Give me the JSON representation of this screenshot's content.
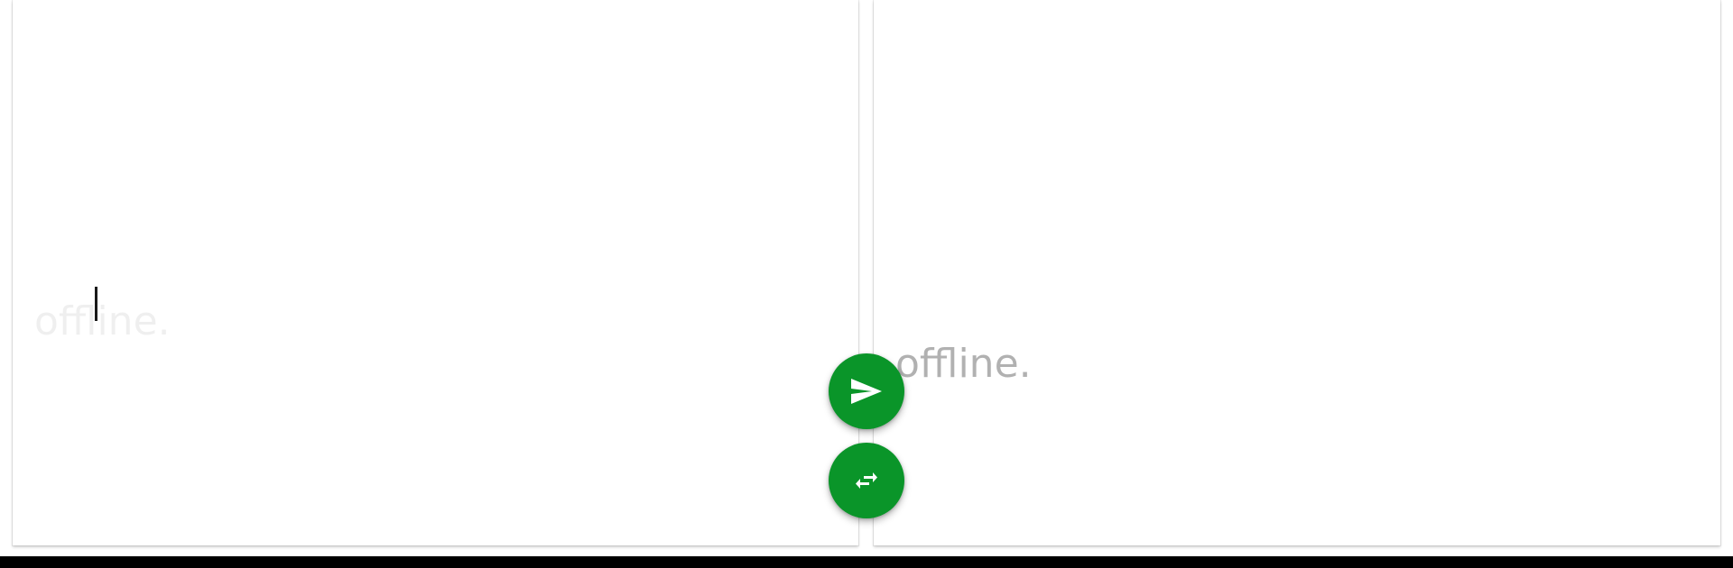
{
  "source_panel": {
    "line_1": "",
    "line_2": "offline."
  },
  "target_panel": {
    "line_1": "",
    "line_2": "offline."
  },
  "actions": {
    "send_icon": "send-icon",
    "swap_icon": "swap-arrows-icon"
  },
  "colors": {
    "accent": "#0a9529",
    "background": "#ffffff",
    "bottom_bar": "#000000"
  }
}
